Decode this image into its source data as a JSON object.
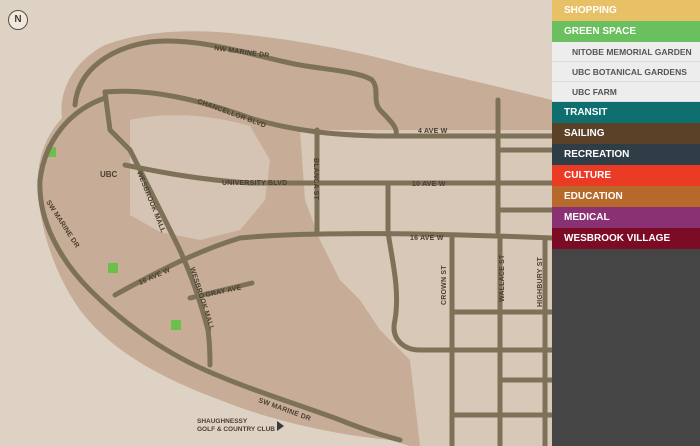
{
  "map": {
    "compass_letter": "N",
    "area_label": "UBC",
    "roads": {
      "nw_marine": "NW MARINE DR",
      "chancellor": "CHANCELLOR BLVD",
      "fourth": "4 AVE W",
      "blanca": "BLANCA ST",
      "university": "UNIVERSITY BLVD",
      "tenth": "10 AVE W",
      "wesbrook_n": "WESBROOK MALL",
      "wesbrook_s": "WESBROOK MALL",
      "sw_marine_w": "SW MARINE DR",
      "sw_marine_s": "SW MARINE DR",
      "sixteenth_e": "16 AVE W",
      "sixteenth_w": "16 AVE W",
      "gray": "GRAY AVE",
      "crown": "CROWN ST",
      "wallace": "WALLACE ST",
      "highbury": "HIGHBURY ST"
    },
    "poi": {
      "line1": "SHAUGHNESSY",
      "line2": "GOLF & COUNTRY CLUB"
    },
    "colors": {
      "background": "#ddd2c4",
      "land": "#c7ad98",
      "land_dark": "#bea58f",
      "road": "#7d7157",
      "green_marker": "#6cbf4a"
    }
  },
  "categories": [
    {
      "label": "SHOPPING",
      "color": "#e8c167"
    },
    {
      "label": "GREEN SPACE",
      "color": "#6abf5e",
      "children": [
        "NITOBE MEMORIAL GARDEN",
        "UBC BOTANICAL GARDENS",
        "UBC FARM"
      ]
    },
    {
      "label": "TRANSIT",
      "color": "#0f6f6f"
    },
    {
      "label": "SAILING",
      "color": "#5a4128"
    },
    {
      "label": "RECREATION",
      "color": "#2f3d47"
    },
    {
      "label": "CULTURE",
      "color": "#ec3b24"
    },
    {
      "label": "EDUCATION",
      "color": "#b6692a"
    },
    {
      "label": "MEDICAL",
      "color": "#8a3174"
    },
    {
      "label": "WESBROOK VILLAGE",
      "color": "#7c0c26"
    }
  ]
}
